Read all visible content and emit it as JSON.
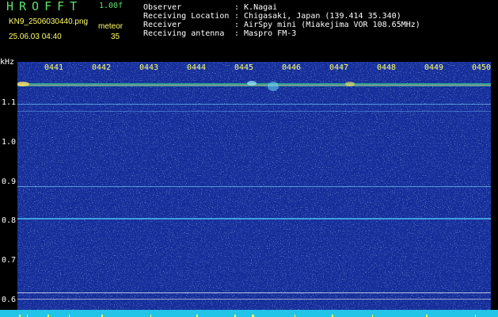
{
  "header": {
    "app_title": "HROFFT",
    "version": "1.00f",
    "file_name": "KN9_2506030440.png",
    "meteor_label": "meteor",
    "datetime": "25.06.03 04:40",
    "meteor_count": "35"
  },
  "info": [
    {
      "label": "Observer",
      "value": ": K.Nagai"
    },
    {
      "label": "Receiving Location",
      "value": ": Chigasaki, Japan (139.414 35.340)"
    },
    {
      "label": "Receiver",
      "value": ": AirSpy mini (Miakejima VOR 108.65MHz)"
    },
    {
      "label": "Receiving antenna",
      "value": ": Maspro FM-3"
    }
  ],
  "axis": {
    "unit": "kHz",
    "y_ticks": [
      "1.1",
      "1.0",
      "0.9",
      "0.8",
      "0.7",
      "0.6"
    ],
    "time_ticks": [
      "0441",
      "0442",
      "0443",
      "0444",
      "0445",
      "0446",
      "0447",
      "0448",
      "0449",
      "0450"
    ]
  },
  "colors": {
    "background": "#142d9a",
    "title": "#5fe06a",
    "tick_label": "#ffff66",
    "bottom_bar": "#22c4e8"
  }
}
